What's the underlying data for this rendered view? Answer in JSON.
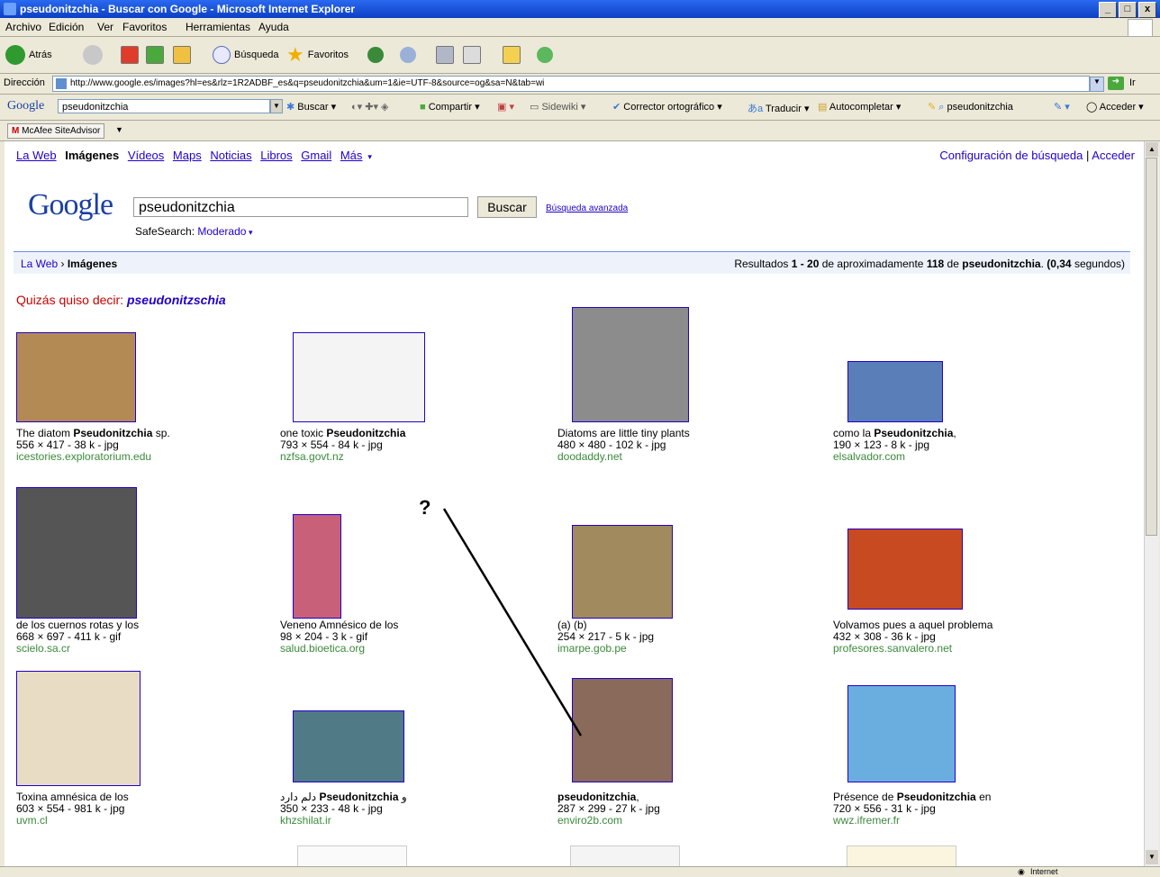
{
  "window": {
    "title": "pseudonitzchia - Buscar con Google - Microsoft Internet Explorer",
    "buttons": [
      "_",
      "□",
      "x"
    ]
  },
  "menu": [
    "Archivo",
    "Edición",
    "Ver",
    "Favoritos",
    "Herramientas",
    "Ayuda"
  ],
  "toolbar": {
    "back": "Atrás",
    "search": "Búsqueda",
    "favorites": "Favoritos"
  },
  "address": {
    "label": "Dirección",
    "url": "http://www.google.es/images?hl=es&rlz=1R2ADBF_es&q=pseudonitzchia&um=1&ie=UTF-8&source=og&sa=N&tab=wi",
    "go": "Ir"
  },
  "google_toolbar": {
    "logo": "Google",
    "query": "pseudonitzchia",
    "buscar": "Buscar",
    "compartir": "Compartir",
    "sidewiki": "Sidewiki",
    "corrector": "Corrector ortográfico",
    "traducir": "Traducir",
    "autocompletar": "Autocompletar",
    "query_chip": "pseudonitzchia",
    "acceder": "Acceder"
  },
  "mcafee": "McAfee SiteAdvisor",
  "page": {
    "nav": {
      "web": "La Web",
      "images": "Imágenes",
      "videos": "Vídeos",
      "maps": "Maps",
      "news": "Noticias",
      "books": "Libros",
      "gmail": "Gmail",
      "more": "Más"
    },
    "settings_link": "Configuración de búsqueda",
    "separator": "|",
    "signin_link": "Acceder",
    "logo": "Google",
    "search_value": "pseudonitzchia",
    "search_button": "Buscar",
    "advanced": "Búsqueda avanzada",
    "safesearch_label": "SafeSearch:",
    "safesearch_value": "Moderado",
    "crumb_web": "La Web",
    "crumb_images": "Imágenes",
    "stats_prefix": "Resultados",
    "stats_range": "1 - 20",
    "stats_mid": "de aproximadamente",
    "stats_count": "118",
    "stats_de": "de",
    "stats_query": "pseudonitzchia",
    "stats_time": "(0,34",
    "stats_secs": "segundos)",
    "didyoumean_label": "Quizás quiso decir:",
    "didyoumean_term": "pseudonitzschia",
    "annotation": "?"
  },
  "results": [
    {
      "pre": "The diatom ",
      "bold": "Pseudonitzchia",
      "post": " sp.",
      "meta": "556 × 417 - 38 k - jpg",
      "site": "icestories.exploratorium.edu",
      "color": "#b38a54"
    },
    {
      "pre": "one toxic ",
      "bold": "Pseudonitzchia",
      "post": "",
      "meta": "793 × 554 - 84 k - jpg",
      "site": "nzfsa.govt.nz",
      "color": "#f4f4f4"
    },
    {
      "pre": "Diatoms are little tiny plants",
      "bold": "",
      "post": "",
      "meta": "480 × 480 - 102 k - jpg",
      "site": "doodaddy.net",
      "color": "#8c8c8c"
    },
    {
      "pre": "como la ",
      "bold": "Pseudonitzchia",
      "post": ",",
      "meta": "190 × 123 - 8 k - jpg",
      "site": "elsalvador.com",
      "color": "#5a7fb8"
    },
    {
      "pre": "de los cuernos rotas y los",
      "bold": "",
      "post": "",
      "meta": "668 × 697 - 411 k - gif",
      "site": "scielo.sa.cr",
      "color": "#555555"
    },
    {
      "pre": "Veneno Amnésico de los",
      "bold": "",
      "post": "",
      "meta": "98 × 204 - 3 k - gif",
      "site": "salud.bioetica.org",
      "color": "#c8607a"
    },
    {
      "pre": "(a) (b)",
      "bold": "",
      "post": "",
      "meta": "254 × 217 - 5 k - jpg",
      "site": "imarpe.gob.pe",
      "color": "#a08a5e"
    },
    {
      "pre": "Volvamos pues a aquel problema",
      "bold": "",
      "post": "",
      "meta": "432 × 308 - 36 k - jpg",
      "site": "profesores.sanvalero.net",
      "color": "#c84a20"
    },
    {
      "pre": "Toxina amnésica de los",
      "bold": "",
      "post": "",
      "meta": "603 × 554 - 981 k - jpg",
      "site": "uvm.cl",
      "color": "#e8dcc4"
    },
    {
      "pre": "دلم دارد ",
      "bold": "Pseudonitzchia",
      "post": " و",
      "meta": "350 × 233 - 48 k - jpg",
      "site": "khzshilat.ir",
      "color": "#4f7a86"
    },
    {
      "pre": "",
      "bold": "pseudonitzchia",
      "post": ",",
      "meta": "287 × 299 - 27 k - jpg",
      "site": "enviro2b.com",
      "color": "#8a6a5a"
    },
    {
      "pre": "Présence de ",
      "bold": "Pseudonitzchia",
      "post": " en",
      "meta": "720 × 556 - 31 k - jpg",
      "site": "wwz.ifremer.fr",
      "color": "#6aaee0"
    }
  ],
  "status": {
    "zone": "Internet"
  }
}
